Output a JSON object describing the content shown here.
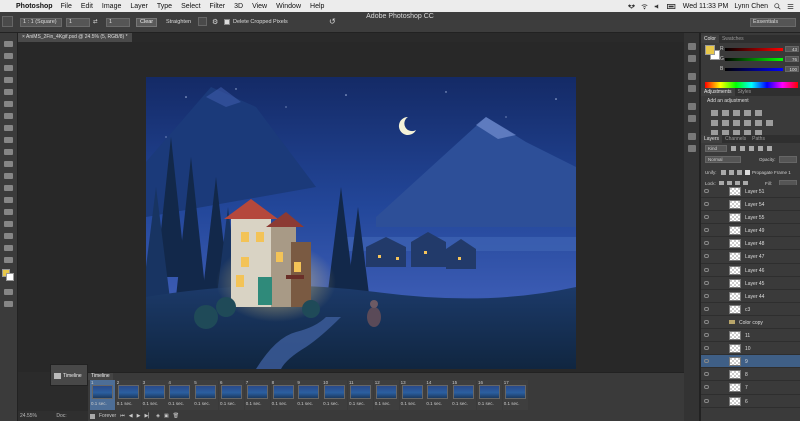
{
  "menubar": {
    "app_name": "Photoshop",
    "items": [
      "File",
      "Edit",
      "Image",
      "Layer",
      "Type",
      "Select",
      "Filter",
      "3D",
      "View",
      "Window",
      "Help"
    ],
    "clock": "Wed 11:33 PM",
    "user": "Lynn Chen"
  },
  "optionsbar": {
    "window_title": "Adobe Photoshop CC",
    "ratio_select": "1 : 1 (Square)",
    "ratio_w": "1",
    "ratio_h": "1",
    "clear_label": "Clear",
    "straighten_label": "Straighten",
    "delete_cropped_label": "Delete Cropped Pixels",
    "workspace": "Essentials"
  },
  "document": {
    "tab_title": "AniMS_2Fin_4Kgif.psd @ 24.5% (5, RGB/8) *"
  },
  "status": {
    "zoom": "24.55%",
    "doc_label": "Doc:"
  },
  "color_panel": {
    "tabs": [
      "Color",
      "Swatches"
    ],
    "r": "43",
    "g": "76",
    "b": "100",
    "r_label": "R",
    "g_label": "G",
    "b_label": "B"
  },
  "adjustments_panel": {
    "tabs": [
      "Adjustments",
      "Styles"
    ],
    "heading": "Add an adjustment"
  },
  "layers_panel": {
    "tabs": [
      "Layers",
      "Channels",
      "Paths"
    ],
    "filter": "Kind",
    "blend_mode": "Normal",
    "opacity_label": "Opacity:",
    "unify_label": "Unify:",
    "propagate_label": "Propagate Frame 1",
    "lock_label": "Lock:",
    "fill_label": "Fill:",
    "rows": [
      {
        "name": "Layer 51",
        "type": "layer"
      },
      {
        "name": "Layer 54",
        "type": "layer"
      },
      {
        "name": "Layer 55",
        "type": "layer"
      },
      {
        "name": "Layer 49",
        "type": "layer"
      },
      {
        "name": "Layer 48",
        "type": "layer"
      },
      {
        "name": "Layer 47",
        "type": "layer"
      },
      {
        "name": "Layer 46",
        "type": "layer"
      },
      {
        "name": "Layer 45",
        "type": "layer"
      },
      {
        "name": "Layer 44",
        "type": "layer"
      },
      {
        "name": "c3",
        "type": "layer"
      },
      {
        "name": "Color copy",
        "type": "group"
      },
      {
        "name": "11",
        "type": "layer"
      },
      {
        "name": "10",
        "type": "layer"
      },
      {
        "name": "9",
        "type": "layer",
        "selected": true
      },
      {
        "name": "8",
        "type": "layer"
      },
      {
        "name": "7",
        "type": "layer"
      },
      {
        "name": "6",
        "type": "layer"
      }
    ]
  },
  "timeline": {
    "panel_label": "Timeline",
    "side_label": "Timeline",
    "loop": "Forever",
    "frames": [
      {
        "n": "1",
        "delay": "0.1 sec."
      },
      {
        "n": "2",
        "delay": "0.1 sec."
      },
      {
        "n": "3",
        "delay": "0.1 sec."
      },
      {
        "n": "4",
        "delay": "0.1 sec."
      },
      {
        "n": "5",
        "delay": "0.1 sec."
      },
      {
        "n": "6",
        "delay": "0.1 sec."
      },
      {
        "n": "7",
        "delay": "0.1 sec."
      },
      {
        "n": "8",
        "delay": "0.1 sec."
      },
      {
        "n": "9",
        "delay": "0.1 sec."
      },
      {
        "n": "10",
        "delay": "0.1 sec."
      },
      {
        "n": "11",
        "delay": "0.1 sec."
      },
      {
        "n": "12",
        "delay": "0.1 sec."
      },
      {
        "n": "13",
        "delay": "0.1 sec."
      },
      {
        "n": "14",
        "delay": "0.1 sec."
      },
      {
        "n": "15",
        "delay": "0.1 sec."
      },
      {
        "n": "16",
        "delay": "0.1 sec."
      },
      {
        "n": "17",
        "delay": "0.1 sec."
      }
    ]
  },
  "colors": {
    "foreground": "#e8c84a",
    "background": "#ffffff",
    "selection": "#3f5f86"
  }
}
